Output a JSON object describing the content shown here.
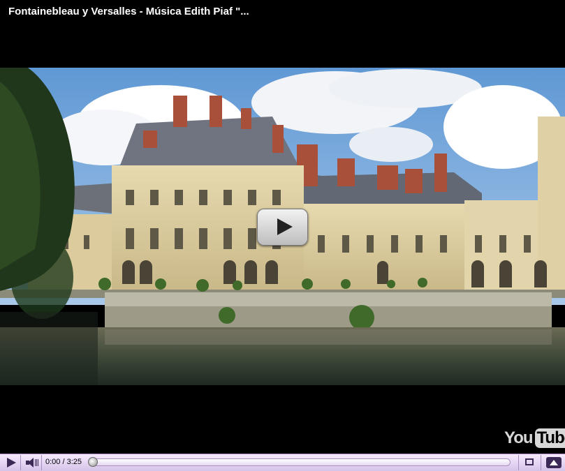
{
  "video_title": "Fontainebleau y Versalles - Música Edith Piaf \"...",
  "player": {
    "time_display": "0:00 / 3:25",
    "progress": 0,
    "logo": {
      "you": "You",
      "tube": "Tube"
    }
  },
  "icons": {
    "play": "play-icon",
    "volume": "speaker-icon",
    "fullscreen": "fullscreen-icon",
    "popout": "popout-icon",
    "big_play": "big-play-icon"
  }
}
